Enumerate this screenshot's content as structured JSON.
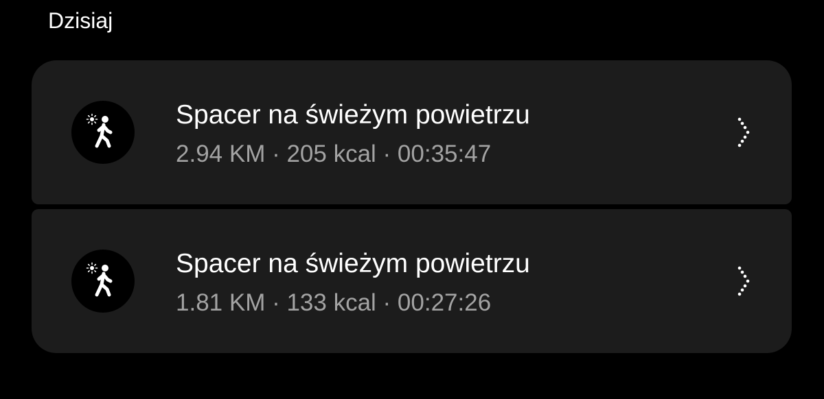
{
  "section": {
    "title": "Dzisiaj"
  },
  "activities": [
    {
      "icon": "outdoor-walk-icon",
      "title": "Spacer na świeżym powietrzu",
      "stats": "2.94 KM · 205 kcal · 00:35:47"
    },
    {
      "icon": "outdoor-walk-icon",
      "title": "Spacer na świeżym powietrzu",
      "stats": "1.81 KM · 133 kcal · 00:27:26"
    }
  ],
  "colors": {
    "background": "#000000",
    "card": "#1c1c1c",
    "title_text": "#ffffff",
    "secondary_text": "#a3a3a3"
  }
}
